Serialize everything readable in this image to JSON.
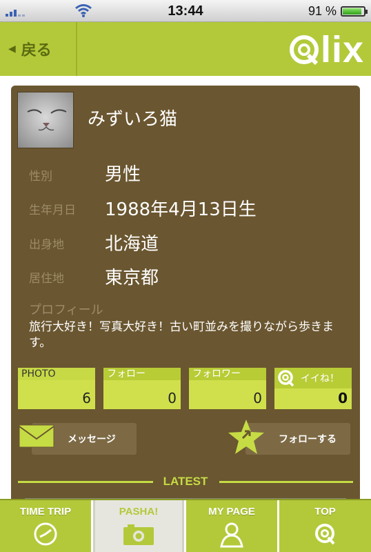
{
  "status_bar": {
    "time": "13:44",
    "battery": "91 %"
  },
  "header": {
    "back_label": "戻る",
    "logo_text": "lix"
  },
  "profile": {
    "name": "みずいろ猫",
    "fields": [
      {
        "label": "性別",
        "value": "男性"
      },
      {
        "label": "生年月日",
        "value": "1988年4月13日生"
      },
      {
        "label": "出身地",
        "value": "北海道"
      },
      {
        "label": "居住地",
        "value": "東京都"
      }
    ],
    "profile_label": "プロフィール",
    "profile_text": "旅行大好き！写真大好き！古い町並みを撮りながら歩きます。"
  },
  "stats": [
    {
      "label": "PHOTO",
      "value": "6"
    },
    {
      "label": "フォロー",
      "value": "0"
    },
    {
      "label": "フォロワー",
      "value": "0"
    },
    {
      "label": "イイね！",
      "value": "0"
    }
  ],
  "actions": {
    "message": "メッセージ",
    "follow": "フォローする"
  },
  "latest_label": "LATEST",
  "tabs": [
    {
      "label": "TIME TRIP",
      "icon": "clock-icon"
    },
    {
      "label": "PASHA!",
      "icon": "camera-icon",
      "active": true
    },
    {
      "label": "MY PAGE",
      "icon": "user-icon"
    },
    {
      "label": "TOP",
      "icon": "qlix-icon"
    }
  ],
  "colors": {
    "accent": "#b3c93a",
    "card": "#6a5630"
  }
}
